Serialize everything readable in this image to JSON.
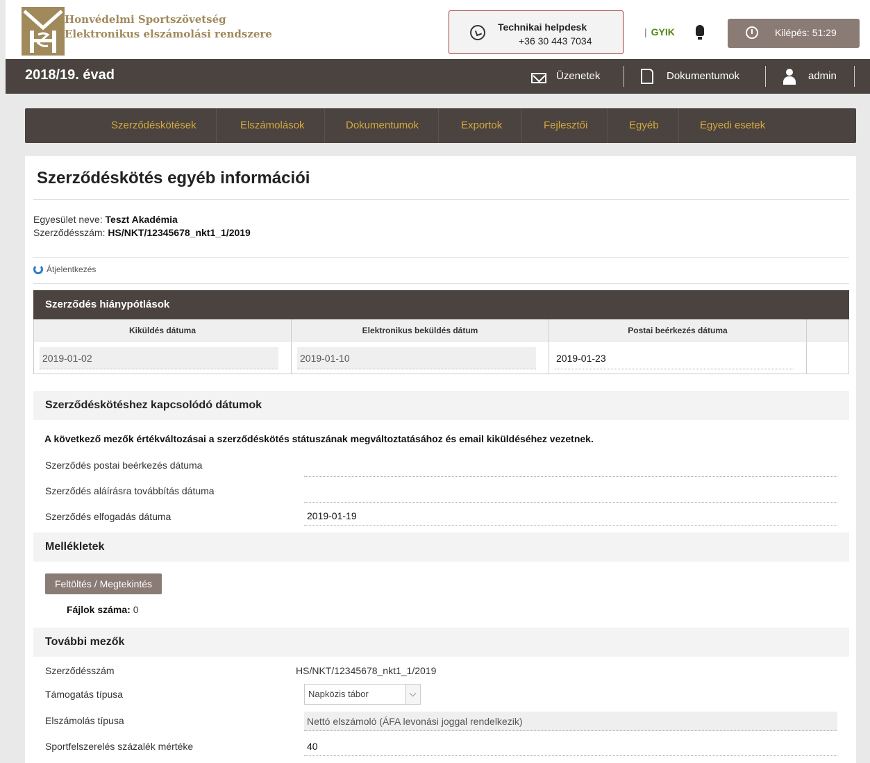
{
  "brand": {
    "line1": "Honvédelmi Sportszövetség",
    "line2": "Elektronikus elszámolási rendszere"
  },
  "helpdesk": {
    "title": "Technikai helpdesk",
    "phone": "+36 30 443 7034",
    "icon": "whatsapp-icon"
  },
  "header": {
    "separator": "|",
    "faq": "GYIK",
    "logout": "Kilépés: 51:29"
  },
  "season": "2018/19. évad",
  "topnav": {
    "messages": "Üzenetek",
    "documents": "Dokumentumok",
    "user": "admin"
  },
  "mainnav": [
    "Szerződéskötések",
    "Elszámolások",
    "Dokumentumok",
    "Exportok",
    "Fejlesztői",
    "Egyéb",
    "Egyedi esetek"
  ],
  "page": {
    "title": "Szerződéskötés egyéb információi",
    "club_label": "Egyesület neve:",
    "club_value": "Teszt Akadémia",
    "contract_label": "Szerződésszám:",
    "contract_value": "HS/NKT/12345678_nkt1_1/2019",
    "reannounce": "Átjelentkezés"
  },
  "deficiency": {
    "title": "Szerződés hiánypótlások",
    "columns": [
      "Kiküldés dátuma",
      "Elektronikus beküldés dátum",
      "Postai beérkezés dátuma"
    ],
    "row": [
      "2019-01-02",
      "2019-01-10",
      "2019-01-23"
    ]
  },
  "dates": {
    "title": "Szerződéskötéshez kapcsolódó dátumok",
    "warning": "A következő mezők értékváltozásai a szerződéskötés státuszának megváltoztatásához és email kiküldéséhez vezetnek.",
    "fields": [
      {
        "label": "Szerződés postai beérkezés dátuma",
        "value": ""
      },
      {
        "label": "Szerződés aláírásra továbbítás dátuma",
        "value": ""
      },
      {
        "label": "Szerződés elfogadás dátuma",
        "value": "2019-01-19"
      }
    ]
  },
  "attachments": {
    "title": "Mellékletek",
    "button": "Feltöltés / Megtekintés",
    "count_label": "Fájlok száma:",
    "count_value": "0"
  },
  "more": {
    "title": "További mezők",
    "contract_label": "Szerződésszám",
    "contract_value": "HS/NKT/12345678_nkt1_1/2019",
    "support_label": "Támogatás típusa",
    "support_value": "Napközis tábor",
    "accounting_label": "Elszámolás típusa",
    "accounting_value": "Nettó elszámoló (ÁFA levonási joggal rendelkezik)",
    "equipment_label": "Sportfelszerelés százalék mértéke",
    "equipment_value": "40"
  },
  "colors": {
    "accent": "#d6a83c",
    "dark": "#4a4340",
    "button": "#8a7b75",
    "faq": "#4f8a10"
  }
}
